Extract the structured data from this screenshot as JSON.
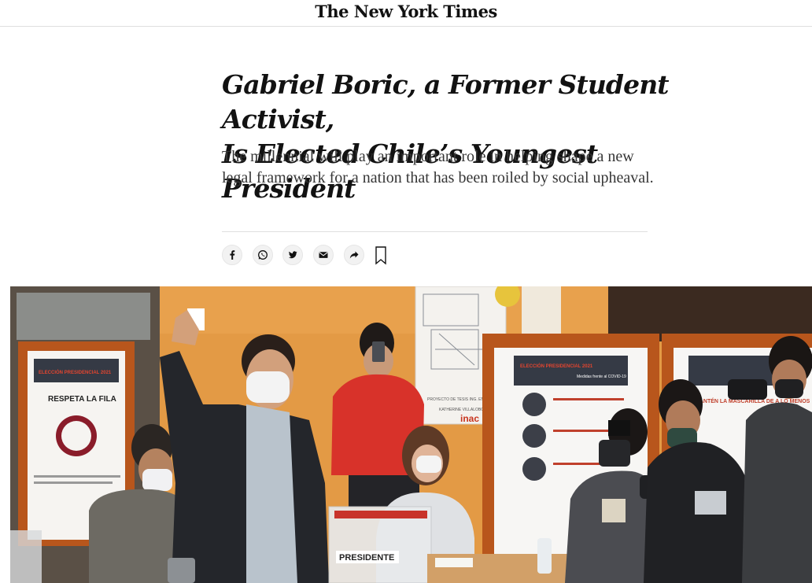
{
  "masthead": {
    "logo_text": "The New York Times"
  },
  "article": {
    "headline_line1": "Gabriel Boric, a Former Student Activist,",
    "headline_line2": "Is Elected Chile’s Youngest President",
    "summary": "The millennial will play an important role in helping shape a new legal framework for a nation that has been roiled by social upheaval."
  },
  "share": {
    "icons": [
      "facebook-icon",
      "whatsapp-icon",
      "twitter-icon",
      "email-icon",
      "share-arrow-icon",
      "bookmark-icon"
    ]
  },
  "photo": {
    "poster_left_header": "ELECCIÓN PRESIDENCIAL 2021",
    "poster_left_title": "RESPETA LA FILA",
    "poster_right_header": "ELECCIÓN PRESIDENCIAL 2021",
    "poster_right_subheader": "Medidas frente al COVID-19",
    "poster_far_right_text": "MANTÉN LA MASCARILLA DE A LO MENOS",
    "ballot_box_label": "PRESIDENTE",
    "map_caption": "PROYECTO DE TESIS ING. EN CALIDAD Y AMBIENTE",
    "map_author": "KATHERINE VILLALOBOS",
    "logo_inac": "inac",
    "colors": {
      "wall": "#e39a45",
      "jacket_red": "#d8322a",
      "suit_dark": "#24262b",
      "poster_border": "#b8561c"
    }
  }
}
